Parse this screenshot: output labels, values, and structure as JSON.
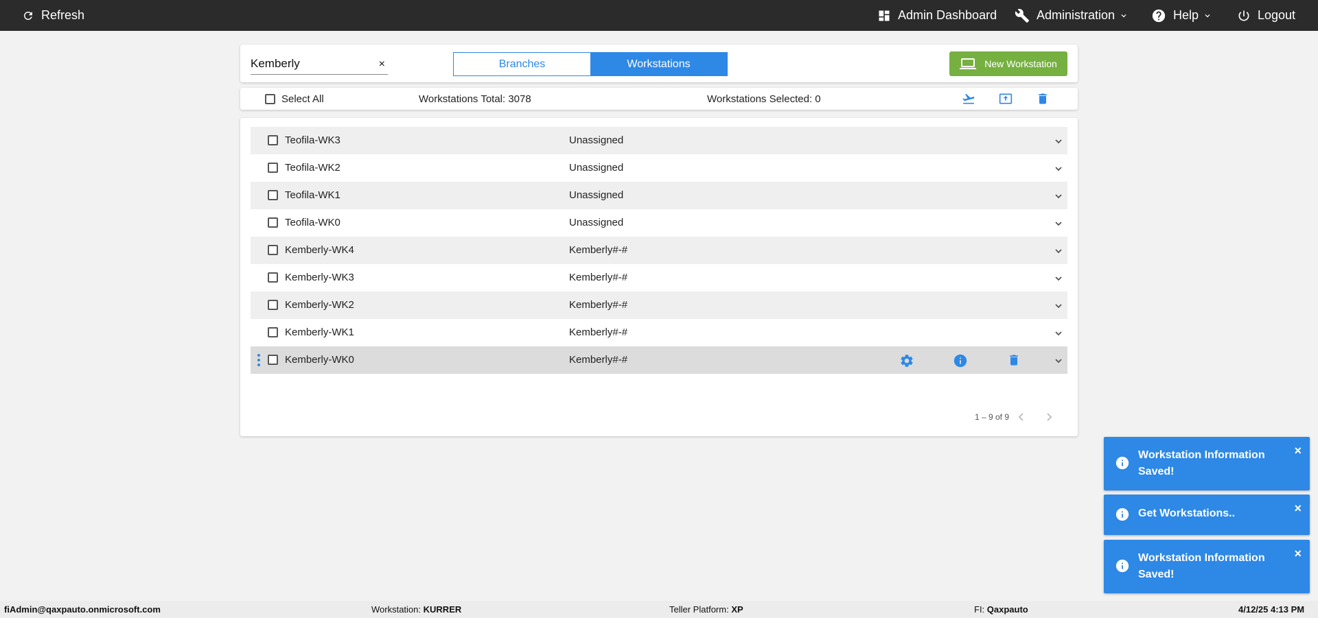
{
  "topbar": {
    "refresh_label": "Refresh",
    "admin_dashboard_label": "Admin Dashboard",
    "administration_label": "Administration",
    "help_label": "Help",
    "logout_label": "Logout"
  },
  "search": {
    "value": "Kemberly",
    "clear_glyph": "×"
  },
  "tabs": {
    "branches_label": "Branches",
    "workstations_label": "Workstations",
    "active": "Workstations"
  },
  "new_workstation_label": "New Workstation",
  "summary": {
    "select_all_label": "Select All",
    "total_text": "Workstations Total: 3078",
    "selected_text": "Workstations Selected: 0"
  },
  "rows": [
    {
      "name": "Teofila-WK3",
      "branch": "Unassigned"
    },
    {
      "name": "Teofila-WK2",
      "branch": "Unassigned"
    },
    {
      "name": "Teofila-WK1",
      "branch": "Unassigned"
    },
    {
      "name": "Teofila-WK0",
      "branch": "Unassigned"
    },
    {
      "name": "Kemberly-WK4",
      "branch": "Kemberly#-#"
    },
    {
      "name": "Kemberly-WK3",
      "branch": "Kemberly#-#"
    },
    {
      "name": "Kemberly-WK2",
      "branch": "Kemberly#-#"
    },
    {
      "name": "Kemberly-WK1",
      "branch": "Kemberly#-#"
    },
    {
      "name": "Kemberly-WK0",
      "branch": "Kemberly#-#"
    }
  ],
  "pager": {
    "range_text": "1 – 9 of 9"
  },
  "toasts": [
    {
      "text": "Workstation Information Saved!"
    },
    {
      "text": "Get Workstations.."
    },
    {
      "text": "Workstation Information Saved!"
    }
  ],
  "toast_close_glyph": "×",
  "statusbar": {
    "user": "fiAdmin@qaxpauto.onmicrosoft.com",
    "workstation_label": "Workstation:",
    "workstation_value": "KURRER",
    "platform_label": "Teller Platform:",
    "platform_value": "XP",
    "fi_label": "FI:",
    "fi_value": "Qaxpauto",
    "datetime": "4/12/25 4:13 PM"
  },
  "colors": {
    "topbar_bg": "#2b2b2b",
    "accent_blue": "#2e88e5",
    "new_button_green": "#76b041",
    "page_bg": "#f2f2f2"
  }
}
